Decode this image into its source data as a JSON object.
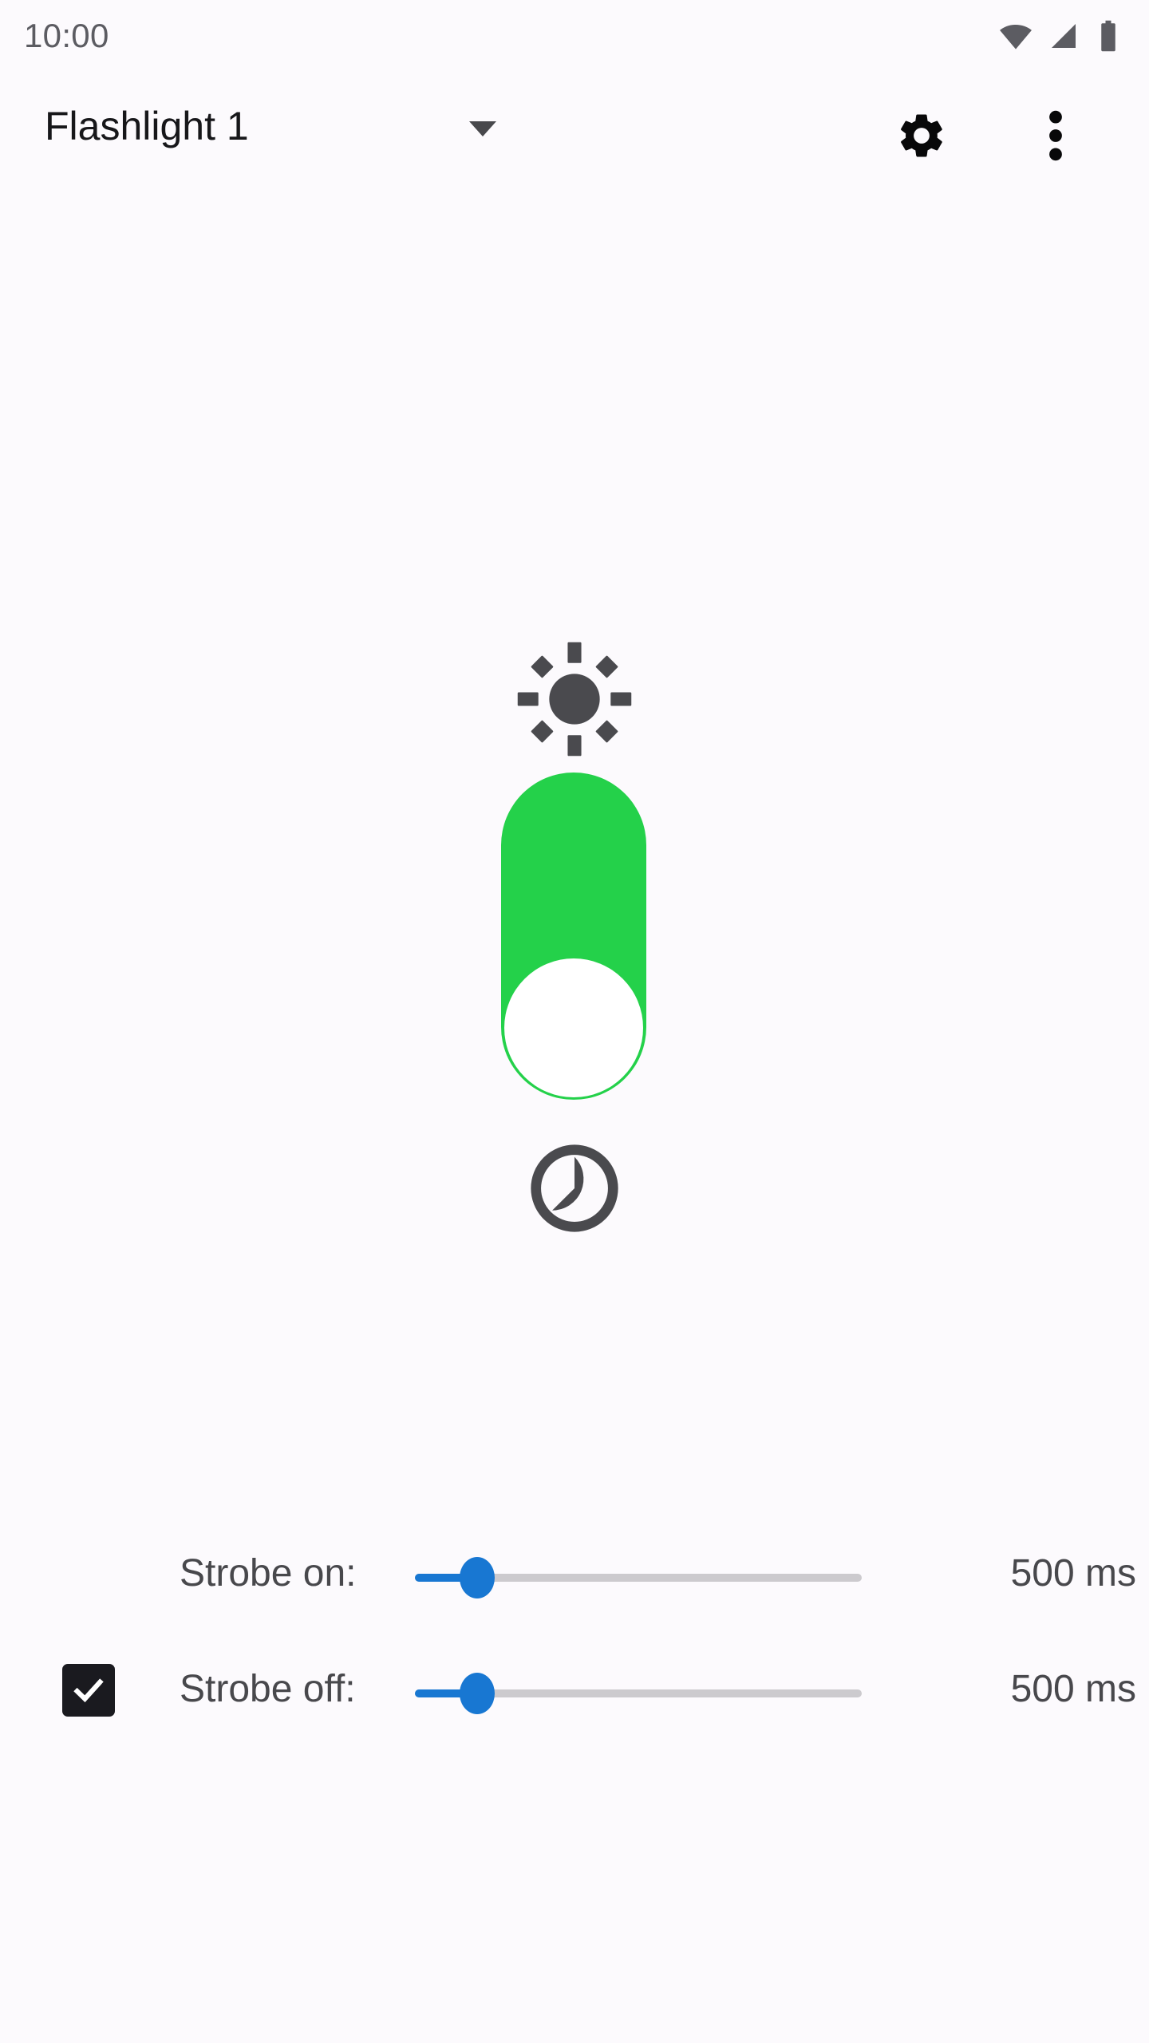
{
  "status_bar": {
    "clock": "10:00",
    "icons": [
      {
        "name": "wifi-icon",
        "label": "Wi-Fi signal full"
      },
      {
        "name": "cellular-signal-icon",
        "label": "Cellular signal"
      },
      {
        "name": "battery-icon",
        "label": "Battery full"
      }
    ],
    "icon_color": "#5c5c62"
  },
  "app_bar": {
    "title": "Flashlight 1",
    "spinner_caret": "dropdown-caret",
    "settings_label": "Settings",
    "overflow_label": "More options",
    "title_color": "#17171a"
  },
  "main": {
    "brightness_top_icon": "brightness-high-icon",
    "brightness_bottom_icon": "brightness-medium-icon",
    "toggle": {
      "name": "flashlight-power-toggle",
      "state": "on",
      "track_color": "#24d14a",
      "thumb_color": "#ffffff",
      "thumb_position": "bottom"
    }
  },
  "strobe": {
    "accent_color": "#1877d2",
    "track_color": "#cccace",
    "rows": [
      {
        "id": "strobe-on",
        "label": "Strobe on:",
        "value": "500 ms",
        "slider_percent": 14,
        "has_checkbox": false,
        "checked": false
      },
      {
        "id": "strobe-off",
        "label": "Strobe off:",
        "value": "500 ms",
        "slider_percent": 14,
        "has_checkbox": true,
        "checked": true
      }
    ]
  }
}
